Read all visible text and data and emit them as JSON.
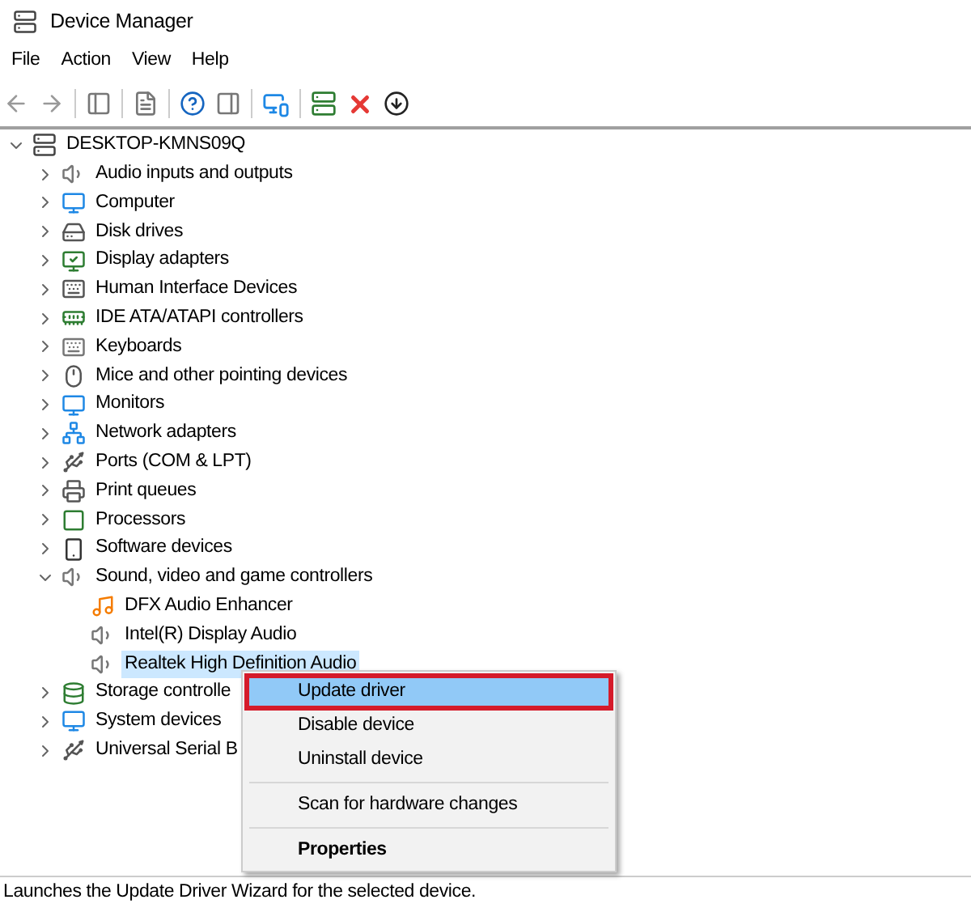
{
  "window": {
    "title": "Device Manager"
  },
  "menu_bar": [
    "File",
    "Action",
    "View",
    "Help"
  ],
  "tree": {
    "label": "DESKTOP-KMNS09Q",
    "expanded": true,
    "children": [
      {
        "label": "Audio inputs and outputs",
        "expanded": false,
        "selected": false
      },
      {
        "label": "Computer",
        "expanded": false,
        "selected": false
      },
      {
        "label": "Disk drives",
        "expanded": false,
        "selected": false
      },
      {
        "label": "Display adapters",
        "expanded": false,
        "selected": false
      },
      {
        "label": "Human Interface Devices",
        "expanded": false,
        "selected": false
      },
      {
        "label": "IDE ATA/ATAPI controllers",
        "expanded": false,
        "selected": false
      },
      {
        "label": "Keyboards",
        "expanded": false,
        "selected": false
      },
      {
        "label": "Mice and other pointing devices",
        "expanded": false,
        "selected": false
      },
      {
        "label": "Monitors",
        "expanded": false,
        "selected": false
      },
      {
        "label": "Network adapters",
        "expanded": false,
        "selected": false
      },
      {
        "label": "Ports (COM & LPT)",
        "expanded": false,
        "selected": false
      },
      {
        "label": "Print queues",
        "expanded": false,
        "selected": false
      },
      {
        "label": "Processors",
        "expanded": false,
        "selected": false
      },
      {
        "label": "Software devices",
        "expanded": false,
        "selected": false
      },
      {
        "label": "Sound, video and game controllers",
        "expanded": true,
        "selected": false,
        "children": [
          {
            "label": "DFX Audio Enhancer",
            "selected": false
          },
          {
            "label": "Intel(R) Display Audio",
            "selected": false
          },
          {
            "label": "Realtek High Definition Audio",
            "selected": true
          }
        ]
      },
      {
        "label": "Storage controlle",
        "expanded": false,
        "selected": false
      },
      {
        "label": "System devices",
        "expanded": false,
        "selected": false
      },
      {
        "label": "Universal Serial B",
        "expanded": false,
        "selected": false
      }
    ]
  },
  "context_menu": [
    {
      "kind": "item",
      "label": "Update driver",
      "selected": true,
      "default": false
    },
    {
      "kind": "item",
      "label": "Disable device",
      "selected": false,
      "default": false
    },
    {
      "kind": "item",
      "label": "Uninstall device",
      "selected": false,
      "default": false
    },
    {
      "kind": "separator"
    },
    {
      "kind": "item",
      "label": "Scan for hardware changes",
      "selected": false,
      "default": false
    },
    {
      "kind": "separator"
    },
    {
      "kind": "item",
      "label": "Properties",
      "selected": false,
      "default": true
    }
  ],
  "status_bar": "Launches the Update Driver Wizard for the selected device."
}
